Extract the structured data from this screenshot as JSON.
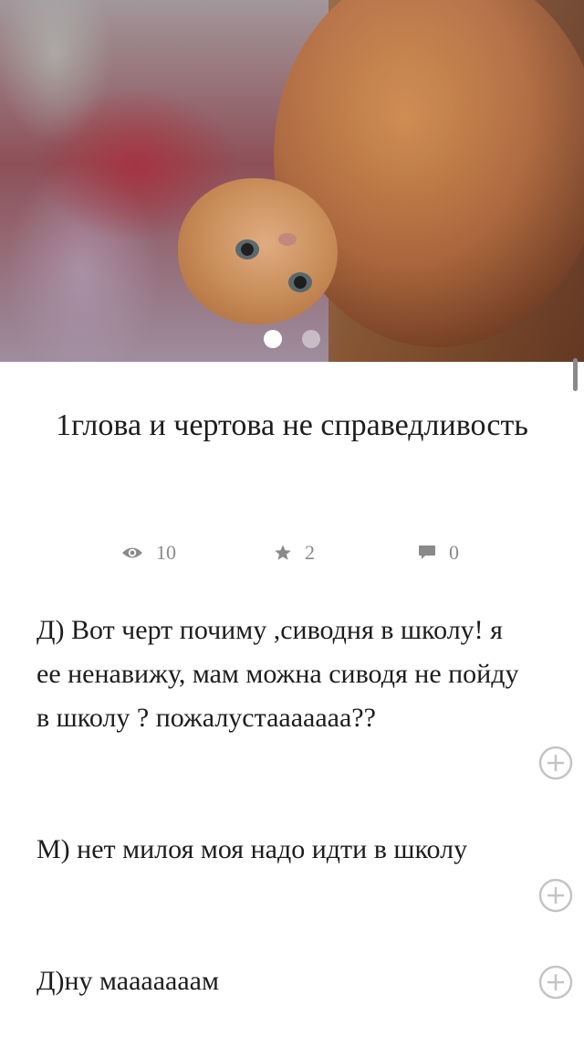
{
  "carousel": {
    "image_icon": "photo-of-kitten",
    "slide_count": 2,
    "active_index": 0
  },
  "story": {
    "title": "1глова и чертова не справедливость"
  },
  "stats": {
    "views": "10",
    "stars": "2",
    "comments": "0",
    "views_icon": "eye-icon",
    "stars_icon": "star-icon",
    "comments_icon": "comment-icon"
  },
  "paragraphs": [
    {
      "text": "Д) Вот черт почиму ,сиводня в школу! я ее ненавижу, мам можна сиводя не пойду в школу ? пожалустаааааaa??",
      "action_icon": "add-circle-icon"
    },
    {
      "text": "М) нет милоя моя надо идти в школу",
      "action_icon": "add-circle-icon"
    },
    {
      "text": "Д)ну маааааaaм",
      "action_icon": "add-circle-icon"
    }
  ],
  "colors": {
    "text": "#1d1d1d",
    "muted": "#8a8a8a",
    "icon_gray": "#c4c4c4"
  }
}
